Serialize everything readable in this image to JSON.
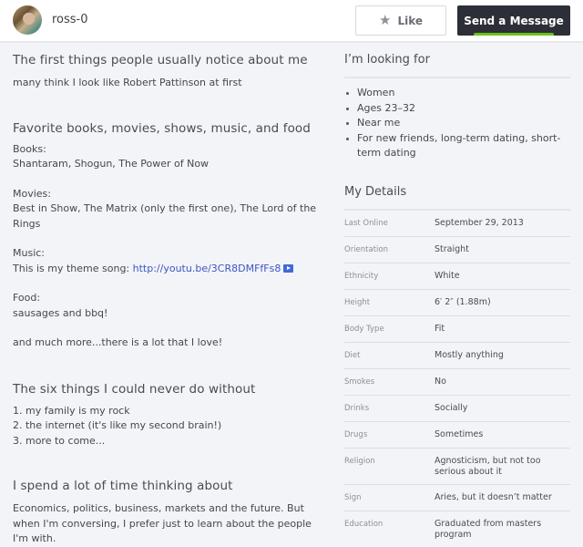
{
  "header": {
    "username": "ross-0",
    "like_label": "Like",
    "like_icon": "star-icon",
    "message_label": "Send a Message",
    "accent_color": "#6ac21b"
  },
  "essays": [
    {
      "title": "The first things people usually notice about me",
      "lines": [
        "many think I look like Robert Pattinson at first"
      ]
    },
    {
      "title": "Favorite books, movies, shows, music, and food",
      "books_label": "Books:",
      "books": "Shantaram, Shogun, The Power of Now",
      "movies_label": "Movies:",
      "movies": "Best in Show, The Matrix (only the first one), The Lord of the Rings",
      "music_label": "Music:",
      "music_prefix": "This is my theme song: ",
      "music_link": "http://youtu.be/3CR8DMFfFs8",
      "music_link_icon": "youtube-play-icon",
      "food_label": "Food:",
      "food": "sausages and bbq!",
      "closing": "and much more...there is a lot that I love!"
    },
    {
      "title": "The six things I could never do without",
      "lines": [
        "1. my family is my rock",
        "2. the internet (it's like my second brain!)",
        "3. more to come..."
      ]
    },
    {
      "title": "I spend a lot of time thinking about",
      "lines": [
        "Economics, politics, business, markets and the future. But when I'm conversing, I prefer just to learn about the people I'm with."
      ]
    }
  ],
  "looking_for": {
    "title": "I’m looking for",
    "items": [
      "Women",
      "Ages 23–32",
      "Near me",
      "For new friends, long-term dating, short-term dating"
    ]
  },
  "details": {
    "title": "My Details",
    "rows": [
      {
        "label": "Last Online",
        "value": "September 29, 2013"
      },
      {
        "label": "Orientation",
        "value": "Straight"
      },
      {
        "label": "Ethnicity",
        "value": "White"
      },
      {
        "label": "Height",
        "value": "6′ 2″ (1.88m)"
      },
      {
        "label": "Body Type",
        "value": "Fit"
      },
      {
        "label": "Diet",
        "value": "Mostly anything"
      },
      {
        "label": "Smokes",
        "value": "No"
      },
      {
        "label": "Drinks",
        "value": "Socially"
      },
      {
        "label": "Drugs",
        "value": "Sometimes"
      },
      {
        "label": "Religion",
        "value": "Agnosticism, but not too serious about it"
      },
      {
        "label": "Sign",
        "value": "Aries, but it doesn’t matter"
      },
      {
        "label": "Education",
        "value": "Graduated from masters program"
      }
    ]
  }
}
